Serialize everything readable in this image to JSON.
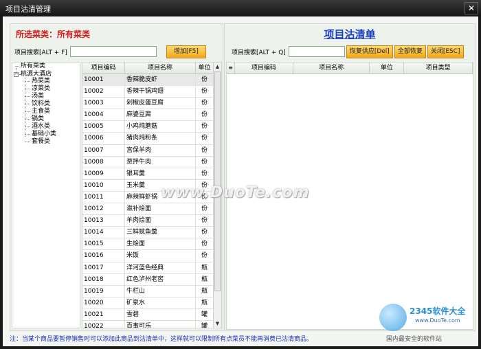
{
  "window": {
    "title": "项目沽清管理",
    "close_label": "✕"
  },
  "left": {
    "category_title": "所选菜类：所有菜类",
    "search_label": "项目搜索[ALT + F]",
    "search_value": "",
    "add_button": "增加[F5]",
    "tree": {
      "root": "所有菜类",
      "store": "桃源大酒店",
      "categories": [
        "热菜类",
        "凉菜类",
        "汤类",
        "饮料类",
        "主食类",
        "锅类",
        "酒水类",
        "基础小类",
        "套餐类"
      ]
    },
    "columns": [
      "项目编码",
      "项目名称",
      "单位"
    ],
    "rows": [
      [
        "10001",
        "香辣脆皮虾",
        "份"
      ],
      [
        "10002",
        "香辣干锅鸡翅",
        "份"
      ],
      [
        "10003",
        "剁椒皮蛋豆腐",
        "份"
      ],
      [
        "10004",
        "麻婆豆腐",
        "份"
      ],
      [
        "10005",
        "小鸡炖蘑菇",
        "份"
      ],
      [
        "10006",
        "猪肉炖粉条",
        "份"
      ],
      [
        "10007",
        "宫保羊肉",
        "份"
      ],
      [
        "10008",
        "葱拌牛肉",
        "份"
      ],
      [
        "10009",
        "银耳羹",
        "份"
      ],
      [
        "10010",
        "玉米羹",
        "份"
      ],
      [
        "10011",
        "麻辣鲜虾锅",
        "份"
      ],
      [
        "10012",
        "滋补烩面",
        "份"
      ],
      [
        "10013",
        "羊肉烩面",
        "份"
      ],
      [
        "10014",
        "三鲜鱿鱼羹",
        "份"
      ],
      [
        "10015",
        "生烩面",
        "份"
      ],
      [
        "10016",
        "米饭",
        "份"
      ],
      [
        "10017",
        "洋河蓝色经典",
        "瓶"
      ],
      [
        "10018",
        "红色泸州老窖",
        "瓶"
      ],
      [
        "10019",
        "牛栏山",
        "瓶"
      ],
      [
        "10020",
        "矿泉水",
        "瓶"
      ],
      [
        "10021",
        "雪碧",
        "罐"
      ],
      [
        "10022",
        "百事可乐",
        "罐"
      ]
    ]
  },
  "right": {
    "title": "项目沽清单",
    "search_label": "项目搜索[ALT + Q]",
    "search_value": "",
    "restore_supply_button": "恢复供应[Del]",
    "restore_all_button": "全部恢复",
    "close_button": "关闭[ESC]",
    "columns": [
      "项目编码",
      "项目名称",
      "单位",
      "项目类型"
    ]
  },
  "note": "注：当某个商品要暂停销售时可以添加此商品到沽清单中，这样就可以限制所有点菜员不能再消费已沽清商品。",
  "watermark": "www.DuoTe.com",
  "brand": {
    "name": "2345软件大全",
    "url": "www.DuoTe.com",
    "slogan": "国内最安全的软件站"
  },
  "colors": {
    "category_title": "#cc1f1f",
    "list_title": "#1a3ec8",
    "note": "#1a2fb8",
    "button": "#f2a91a"
  }
}
